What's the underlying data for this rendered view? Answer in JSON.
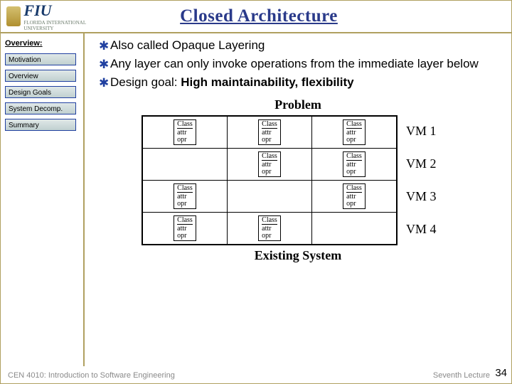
{
  "header": {
    "title": "Closed Architecture",
    "logo_text": "FIU",
    "logo_sub": "FLORIDA INTERNATIONAL UNIVERSITY"
  },
  "sidebar": {
    "heading": "Overview:",
    "items": [
      "Motivation",
      "Overview",
      "Design Goals",
      "System Decomp.",
      "Summary"
    ]
  },
  "bullets": [
    {
      "text": "Also called Opaque Layering"
    },
    {
      "text": "Any layer can only invoke operations from the immediate layer below"
    },
    {
      "prefix": "Design goal: ",
      "bold": "High maintainability, flexibility"
    }
  ],
  "diagram": {
    "top_title": "Problem",
    "bottom_title": "Existing System",
    "class_box": {
      "name": "Class",
      "attr": "attr",
      "opr": "opr"
    },
    "rows": [
      {
        "cells": [
          true,
          true,
          true
        ],
        "label": "VM 1"
      },
      {
        "cells": [
          false,
          true,
          true
        ],
        "label": "VM 2"
      },
      {
        "cells": [
          true,
          false,
          true
        ],
        "label": "VM 3"
      },
      {
        "cells": [
          true,
          true,
          false
        ],
        "label": "VM 4"
      }
    ]
  },
  "footer": {
    "left": "CEN 4010: Introduction to Software Engineering",
    "right": "Seventh Lecture",
    "page": "34"
  }
}
